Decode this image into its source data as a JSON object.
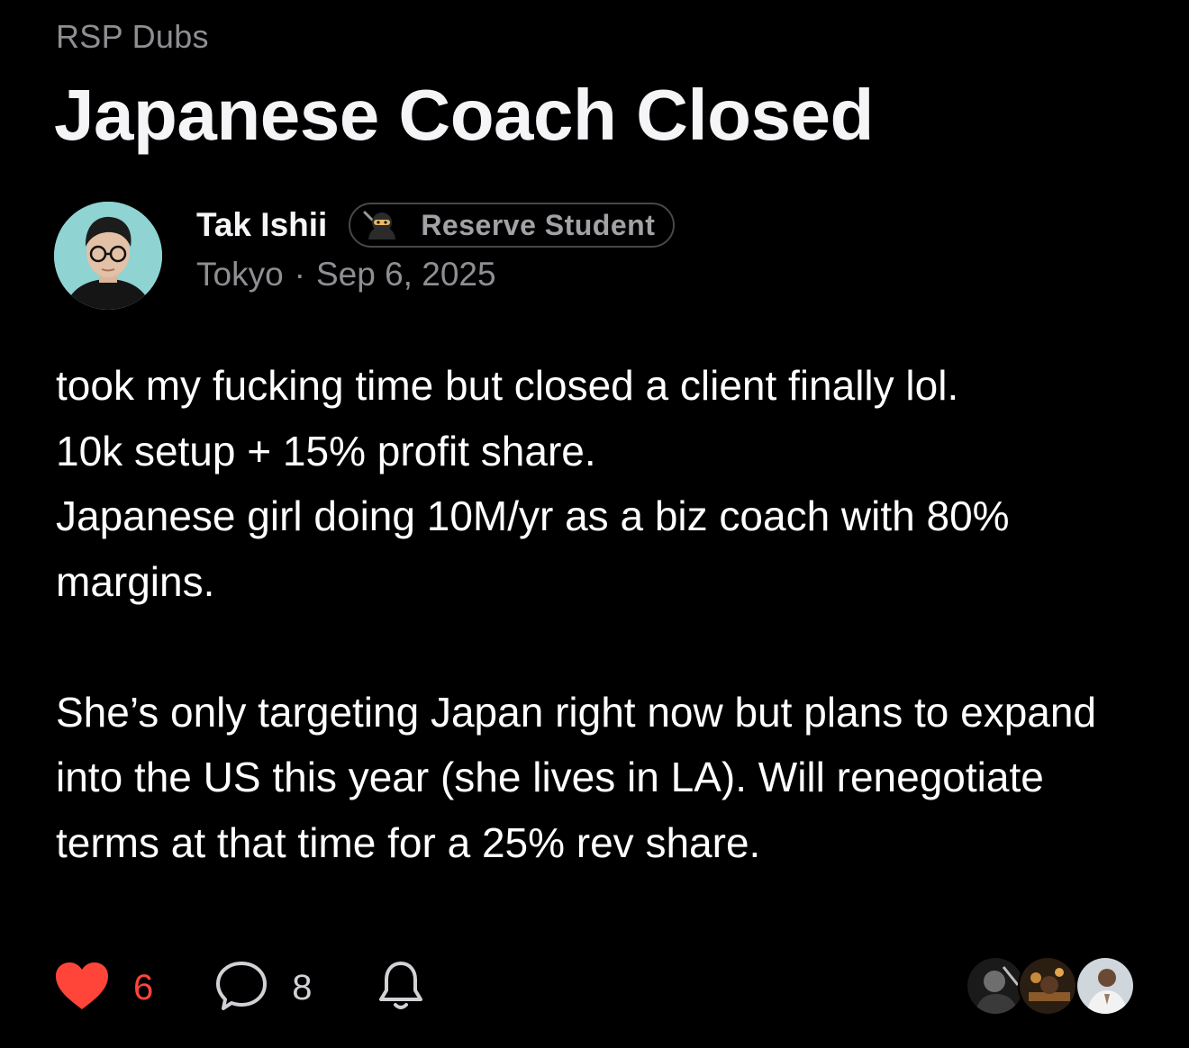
{
  "post": {
    "category": "RSP Dubs",
    "title": "Japanese Coach Closed",
    "author": {
      "name": "Tak Ishii",
      "badge": "Reserve Student",
      "badge_icon": "ninja-icon",
      "location": "Tokyo",
      "separator": "·",
      "date": "Sep 6, 2025"
    },
    "body": {
      "paragraph1": [
        "took my fucking time but closed a client finally lol.",
        "10k setup + 15% profit share.",
        "Japanese girl doing 10M/yr as a biz coach with 80% margins."
      ],
      "paragraph2": "She’s only targeting Japan right now but plans to expand into the US this year (she lives in LA). Will renegotiate terms at that time for a 25% rev share."
    },
    "actions": {
      "like_count": "6",
      "comment_count": "8",
      "like_icon": "heart-icon",
      "comment_icon": "comment-icon",
      "follow_icon": "bell-icon"
    }
  },
  "colors": {
    "background": "#000000",
    "muted_text": "#8e8e93",
    "like_red": "#ff453a",
    "avatar_bg": "#8fd3d3"
  }
}
